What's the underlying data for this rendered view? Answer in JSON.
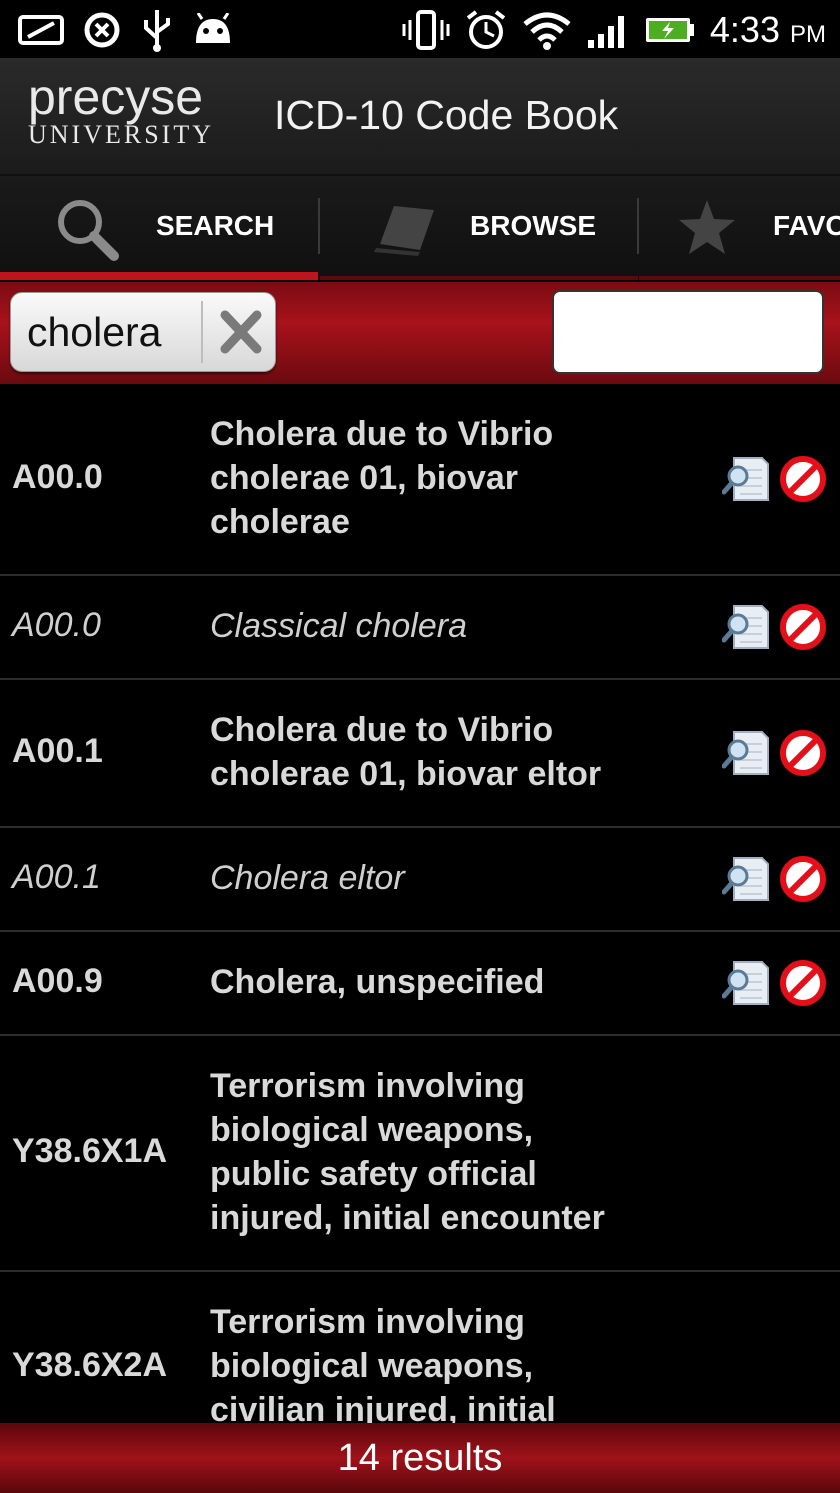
{
  "status_bar": {
    "time": "4:33",
    "ampm": "PM",
    "left_icons": [
      "screen-icon",
      "sync-icon",
      "usb-icon",
      "android-icon"
    ],
    "right_icons": [
      "vibrate-icon",
      "alarm-icon",
      "wifi-icon",
      "signal-icon",
      "battery-icon"
    ]
  },
  "header": {
    "logo_brand": "precyse",
    "logo_sub": "UNIVERSITY",
    "title": "ICD-10 Code Book"
  },
  "tabs": [
    {
      "label": "SEARCH",
      "icon": "search-icon",
      "active": true
    },
    {
      "label": "BROWSE",
      "icon": "book-icon",
      "active": false
    },
    {
      "label": "FAVO",
      "icon": "star-icon",
      "active": false
    }
  ],
  "search": {
    "chip_text": "cholera",
    "input_value": ""
  },
  "results": [
    {
      "code": "A00.0",
      "lines": [
        "Cholera due to Vibrio",
        "cholerae 01, biovar",
        "cholerae"
      ],
      "sub": false,
      "actions": true
    },
    {
      "code": "A00.0",
      "lines": [
        "Classical cholera"
      ],
      "sub": true,
      "actions": true
    },
    {
      "code": "A00.1",
      "lines": [
        "Cholera due to Vibrio",
        "cholerae 01, biovar eltor"
      ],
      "sub": false,
      "actions": true
    },
    {
      "code": "A00.1",
      "lines": [
        "Cholera eltor"
      ],
      "sub": true,
      "actions": true
    },
    {
      "code": "A00.9",
      "lines": [
        "Cholera, unspecified"
      ],
      "sub": false,
      "actions": true
    },
    {
      "code": "Y38.6X1A",
      "lines": [
        "Terrorism involving",
        "biological weapons,",
        "public safety official",
        "injured, initial encounter"
      ],
      "sub": false,
      "actions": false
    },
    {
      "code": "Y38.6X2A",
      "lines": [
        "Terrorism involving",
        "biological weapons,",
        "civilian injured, initial"
      ],
      "sub": false,
      "actions": false
    }
  ],
  "footer": {
    "results_text": "14 results"
  },
  "colors": {
    "accent_red": "#c0141c",
    "no_icon_red": "#e3101a"
  }
}
